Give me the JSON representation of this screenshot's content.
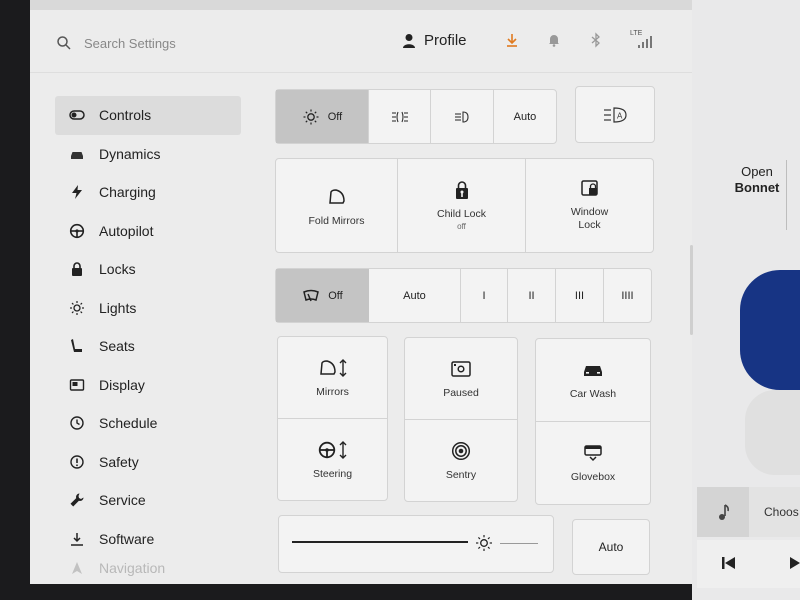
{
  "search": {
    "placeholder": "Search Settings"
  },
  "header": {
    "profile_label": "Profile",
    "cell_label": "LTE"
  },
  "sidebar": {
    "items": [
      {
        "label": "Controls",
        "icon": "toggle-icon"
      },
      {
        "label": "Dynamics",
        "icon": "car-icon"
      },
      {
        "label": "Charging",
        "icon": "bolt-icon"
      },
      {
        "label": "Autopilot",
        "icon": "steering-wheel-icon"
      },
      {
        "label": "Locks",
        "icon": "lock-icon"
      },
      {
        "label": "Lights",
        "icon": "sun-icon"
      },
      {
        "label": "Seats",
        "icon": "seat-icon"
      },
      {
        "label": "Display",
        "icon": "display-icon"
      },
      {
        "label": "Schedule",
        "icon": "clock-icon"
      },
      {
        "label": "Safety",
        "icon": "safety-icon"
      },
      {
        "label": "Service",
        "icon": "wrench-icon"
      },
      {
        "label": "Software",
        "icon": "download-icon"
      },
      {
        "label": "Navigation",
        "icon": "navigation-icon"
      }
    ]
  },
  "lights": {
    "off_label": "Off",
    "auto_label": "Auto"
  },
  "mirrors_locks": {
    "fold_mirrors": "Fold Mirrors",
    "child_lock": "Child Lock",
    "child_lock_state": "off",
    "window_lock_line1": "Window",
    "window_lock_line2": "Lock"
  },
  "wipers": {
    "off_label": "Off",
    "auto_label": "Auto",
    "speeds": [
      "I",
      "II",
      "III",
      "IIII"
    ]
  },
  "tiles": {
    "mirrors": "Mirrors",
    "paused": "Paused",
    "car_wash": "Car Wash",
    "steering": "Steering",
    "sentry": "Sentry",
    "glovebox": "Glovebox"
  },
  "brightness": {
    "auto_label": "Auto",
    "level": 0.78
  },
  "right_panel": {
    "open_line1": "Open",
    "open_line2": "Bonnet",
    "media_label": "Choos"
  },
  "colors": {
    "selected": "#c4c4c4",
    "background": "#ececec",
    "car_blue": "#173484"
  }
}
